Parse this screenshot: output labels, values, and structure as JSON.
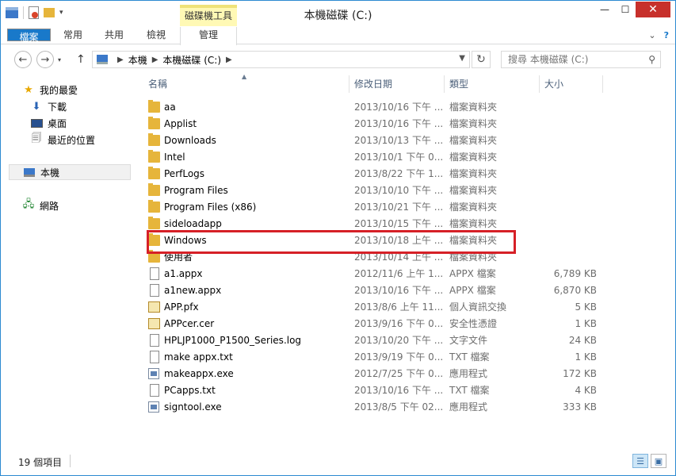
{
  "window": {
    "title": "本機磁碟 (C:)",
    "context_tab": "磁碟機工具",
    "minimize_icon": "minimize-icon",
    "maximize_icon": "maximize-icon",
    "close_icon": "close-icon"
  },
  "ribbon": {
    "tabs": [
      "檔案",
      "常用",
      "共用",
      "檢視",
      "管理"
    ]
  },
  "address": {
    "crumbs": [
      "本機",
      "本機磁碟 (C:)"
    ],
    "search_placeholder": "搜尋 本機磁碟 (C:)"
  },
  "nav": {
    "favorites": "我的最愛",
    "downloads": "下載",
    "desktop": "桌面",
    "recent": "最近的位置",
    "this_pc": "本機",
    "network": "網路"
  },
  "columns": {
    "name": "名稱",
    "date": "修改日期",
    "type": "類型",
    "size": "大小"
  },
  "files": [
    {
      "name": "aa",
      "date": "2013/10/16 下午 ...",
      "type": "檔案資料夾",
      "size": "",
      "icon": "folder-icon"
    },
    {
      "name": "Applist",
      "date": "2013/10/16 下午 ...",
      "type": "檔案資料夾",
      "size": "",
      "icon": "folder-icon"
    },
    {
      "name": "Downloads",
      "date": "2013/10/13 下午 ...",
      "type": "檔案資料夾",
      "size": "",
      "icon": "folder-icon"
    },
    {
      "name": "Intel",
      "date": "2013/10/1 下午 0...",
      "type": "檔案資料夾",
      "size": "",
      "icon": "folder-icon"
    },
    {
      "name": "PerfLogs",
      "date": "2013/8/22 下午 1...",
      "type": "檔案資料夾",
      "size": "",
      "icon": "folder-icon"
    },
    {
      "name": "Program Files",
      "date": "2013/10/10 下午 ...",
      "type": "檔案資料夾",
      "size": "",
      "icon": "folder-icon"
    },
    {
      "name": "Program Files (x86)",
      "date": "2013/10/21 下午 ...",
      "type": "檔案資料夾",
      "size": "",
      "icon": "folder-icon"
    },
    {
      "name": "sideloadapp",
      "date": "2013/10/15 下午 ...",
      "type": "檔案資料夾",
      "size": "",
      "icon": "folder-icon"
    },
    {
      "name": "Windows",
      "date": "2013/10/18 上午 ...",
      "type": "檔案資料夾",
      "size": "",
      "icon": "folder-icon"
    },
    {
      "name": "使用者",
      "date": "2013/10/14 上午 ...",
      "type": "檔案資料夾",
      "size": "",
      "icon": "folder-icon"
    },
    {
      "name": "a1.appx",
      "date": "2012/11/6 上午 1...",
      "type": "APPX 檔案",
      "size": "6,789 KB",
      "icon": "file-icon"
    },
    {
      "name": "a1new.appx",
      "date": "2013/10/16 下午 ...",
      "type": "APPX 檔案",
      "size": "6,870 KB",
      "icon": "file-icon"
    },
    {
      "name": "APP.pfx",
      "date": "2013/8/6 上午 11...",
      "type": "個人資訊交換",
      "size": "5 KB",
      "icon": "certificate-icon"
    },
    {
      "name": "APPcer.cer",
      "date": "2013/9/16 下午 0...",
      "type": "安全性憑證",
      "size": "1 KB",
      "icon": "certificate-icon"
    },
    {
      "name": "HPLJP1000_P1500_Series.log",
      "date": "2013/10/20 下午 ...",
      "type": "文字文件",
      "size": "24 KB",
      "icon": "file-icon"
    },
    {
      "name": "make appx.txt",
      "date": "2013/9/19 下午 0...",
      "type": "TXT 檔案",
      "size": "1 KB",
      "icon": "file-icon"
    },
    {
      "name": "makeappx.exe",
      "date": "2012/7/25 下午 0...",
      "type": "應用程式",
      "size": "172 KB",
      "icon": "exe-icon"
    },
    {
      "name": "PCapps.txt",
      "date": "2013/10/16 下午 ...",
      "type": "TXT 檔案",
      "size": "4 KB",
      "icon": "file-icon"
    },
    {
      "name": "signtool.exe",
      "date": "2013/8/5 下午 02...",
      "type": "應用程式",
      "size": "333 KB",
      "icon": "exe-icon"
    }
  ],
  "status": {
    "count": "19 個項目"
  }
}
